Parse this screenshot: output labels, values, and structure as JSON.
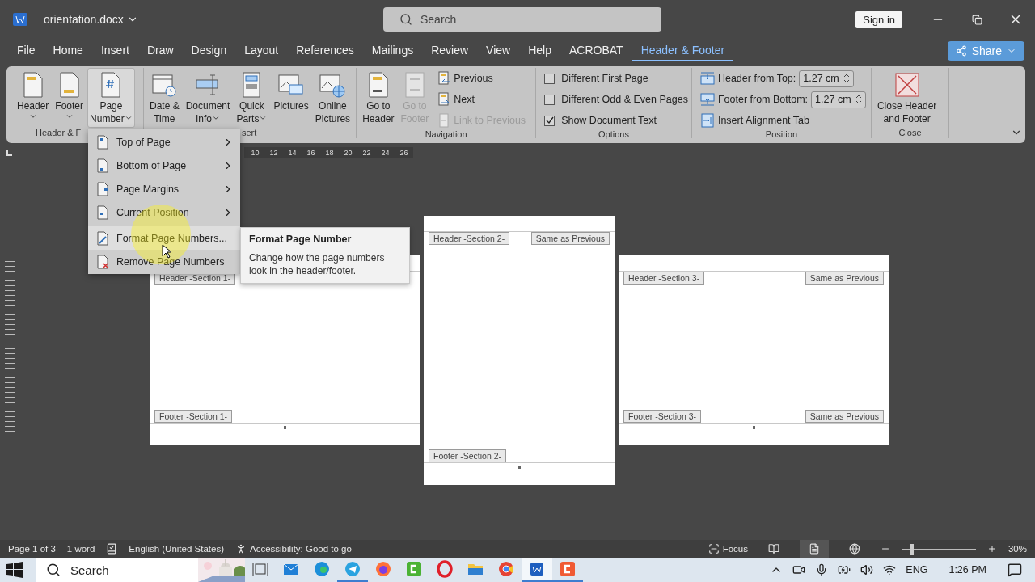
{
  "window": {
    "title": "orientation.docx",
    "search_placeholder": "Search",
    "sign_in": "Sign in"
  },
  "tabs": [
    {
      "label": "File",
      "selected": false
    },
    {
      "label": "Home",
      "selected": false
    },
    {
      "label": "Insert",
      "selected": false
    },
    {
      "label": "Draw",
      "selected": false
    },
    {
      "label": "Design",
      "selected": false
    },
    {
      "label": "Layout",
      "selected": false
    },
    {
      "label": "References",
      "selected": false
    },
    {
      "label": "Mailings",
      "selected": false
    },
    {
      "label": "Review",
      "selected": false
    },
    {
      "label": "View",
      "selected": false
    },
    {
      "label": "Help",
      "selected": false
    },
    {
      "label": "ACROBAT",
      "selected": false
    },
    {
      "label": "Header & Footer",
      "selected": true
    }
  ],
  "share": "Share",
  "ribbon": {
    "groups": [
      {
        "label": "Header & F",
        "items": [
          {
            "kind": "large",
            "lines": [
              "Header"
            ],
            "dropdown": true,
            "expanded": false,
            "disabled": false
          },
          {
            "kind": "large",
            "lines": [
              "Footer"
            ],
            "dropdown": true,
            "expanded": false,
            "disabled": false
          },
          {
            "kind": "large",
            "lines": [
              "Page",
              "Number"
            ],
            "dropdown": true,
            "expanded": true,
            "disabled": false
          }
        ]
      },
      {
        "label": "sert",
        "items": [
          {
            "kind": "large",
            "lines": [
              "Date &",
              "Time"
            ],
            "dropdown": false,
            "expanded": false,
            "disabled": false
          },
          {
            "kind": "large",
            "lines": [
              "Document",
              "Info"
            ],
            "dropdown": true,
            "expanded": false,
            "disabled": false
          },
          {
            "kind": "large",
            "lines": [
              "Quick",
              "Parts"
            ],
            "dropdown": true,
            "expanded": false,
            "disabled": false
          },
          {
            "kind": "large",
            "lines": [
              "Pictures"
            ],
            "dropdown": false,
            "expanded": false,
            "disabled": false
          },
          {
            "kind": "large",
            "lines": [
              "Online",
              "Pictures"
            ],
            "dropdown": false,
            "expanded": false,
            "disabled": false
          }
        ]
      },
      {
        "label": "Navigation",
        "items": [
          {
            "kind": "large",
            "lines": [
              "Go to",
              "Header"
            ],
            "dropdown": false,
            "expanded": false,
            "disabled": false
          },
          {
            "kind": "large",
            "lines": [
              "Go to",
              "Footer"
            ],
            "dropdown": false,
            "expanded": false,
            "disabled": true
          },
          {
            "kind": "small",
            "label": "Previous",
            "disabled": false
          },
          {
            "kind": "small",
            "label": "Next",
            "disabled": false
          },
          {
            "kind": "small",
            "label": "Link to Previous",
            "disabled": true
          }
        ]
      },
      {
        "label": "Options",
        "items": [
          {
            "kind": "check",
            "label": "Different First Page",
            "checked": false
          },
          {
            "kind": "check",
            "label": "Different Odd & Even Pages",
            "checked": false
          },
          {
            "kind": "check",
            "label": "Show Document Text",
            "checked": true
          }
        ]
      },
      {
        "label": "Position",
        "items": [
          {
            "kind": "spin",
            "label": "Header from Top:",
            "value": "1.27 cm"
          },
          {
            "kind": "spin",
            "label": "Footer from Bottom:",
            "value": "1.27 cm"
          },
          {
            "kind": "small",
            "label": "Insert Alignment Tab",
            "disabled": false
          }
        ]
      },
      {
        "label": "Close",
        "items": [
          {
            "kind": "large",
            "lines": [
              "Close Header",
              "and Footer"
            ],
            "dropdown": false,
            "expanded": false,
            "disabled": false
          }
        ]
      }
    ]
  },
  "ruler": {
    "numbers": [
      "10",
      "12",
      "14",
      "16",
      "18",
      "20",
      "22",
      "24",
      "26"
    ]
  },
  "menu": {
    "items": [
      {
        "label": "Top of Page",
        "submenu": true,
        "highlighted": false
      },
      {
        "label": "Bottom of Page",
        "submenu": true,
        "highlighted": false
      },
      {
        "label": "Page Margins",
        "submenu": true,
        "highlighted": false
      },
      {
        "label": "Current Position",
        "submenu": true,
        "highlighted": false
      },
      {
        "label": "Format Page Numbers...",
        "submenu": false,
        "highlighted": true
      },
      {
        "label": "Remove Page Numbers",
        "submenu": false,
        "highlighted": false
      }
    ]
  },
  "tooltip": {
    "title": "Format Page Number",
    "text": "Change how the page numbers look in the header/footer."
  },
  "pages": [
    {
      "kind": "landscape",
      "header_tag": "Header -Section 1-",
      "footer_tag": "Footer -Section 1-"
    },
    {
      "kind": "portrait",
      "header_tag": "Header -Section 2-",
      "header_note": "Same as Previous",
      "footer_tag": "Footer -Section 2-"
    },
    {
      "kind": "landscape",
      "header_tag": "Header -Section 3-",
      "header_note": "Same as Previous",
      "footer_tag": "Footer -Section 3-",
      "footer_note": "Same as Previous"
    }
  ],
  "status_bar": {
    "page": "Page 1 of 3",
    "words": "1 word",
    "language": "English (United States)",
    "accessibility": "Accessibility: Good to go",
    "focus": "Focus",
    "views": [
      {
        "selected": false
      },
      {
        "selected": true
      },
      {
        "selected": false
      }
    ],
    "zoom": {
      "level": 0.13,
      "reading": "30%"
    }
  },
  "taskbar": {
    "search_placeholder": "Search",
    "apps": [
      {
        "running": false,
        "selected": false
      },
      {
        "running": false,
        "selected": false
      },
      {
        "running": false,
        "selected": false
      },
      {
        "running": true,
        "selected": false
      },
      {
        "running": false,
        "selected": false
      },
      {
        "running": false,
        "selected": false
      },
      {
        "running": false,
        "selected": false
      },
      {
        "running": false,
        "selected": false
      },
      {
        "running": false,
        "selected": false
      },
      {
        "running": true,
        "selected": true
      },
      {
        "running": true,
        "selected": false
      }
    ],
    "tray": {
      "language": "ENG",
      "time": "1:26 PM"
    }
  }
}
